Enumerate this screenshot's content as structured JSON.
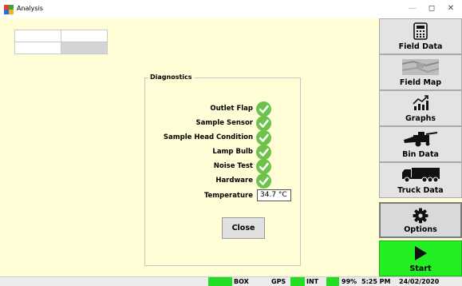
{
  "window": {
    "title": "Analysis",
    "minimize": "—",
    "maximize": "◻",
    "close": "✕"
  },
  "diagnostics": {
    "title": "Diagnostics",
    "checks": [
      {
        "label": "Outlet Flap",
        "status": "ok"
      },
      {
        "label": "Sample Sensor",
        "status": "ok"
      },
      {
        "label": "Sample Head Condition",
        "status": "ok"
      },
      {
        "label": "Lamp Bulb",
        "status": "ok"
      },
      {
        "label": "Noise Test",
        "status": "ok"
      },
      {
        "label": "Hardware",
        "status": "ok"
      }
    ],
    "temperature_label": "Temperature",
    "temperature_value": "34.7 °C",
    "close_label": "Close"
  },
  "nav": {
    "field_data": "Field Data",
    "field_map": "Field Map",
    "graphs": "Graphs",
    "bin_data": "Bin Data",
    "truck_data": "Truck Data",
    "options": "Options",
    "start": "Start"
  },
  "status": {
    "box": "BOX",
    "gps": "GPS",
    "int": "INT",
    "battery": "99%",
    "time": "5:25 PM",
    "date": "24/02/2020"
  },
  "colors": {
    "background": "#fffed6",
    "ok_green": "#6cc24a",
    "start_green": "#22ee22"
  }
}
